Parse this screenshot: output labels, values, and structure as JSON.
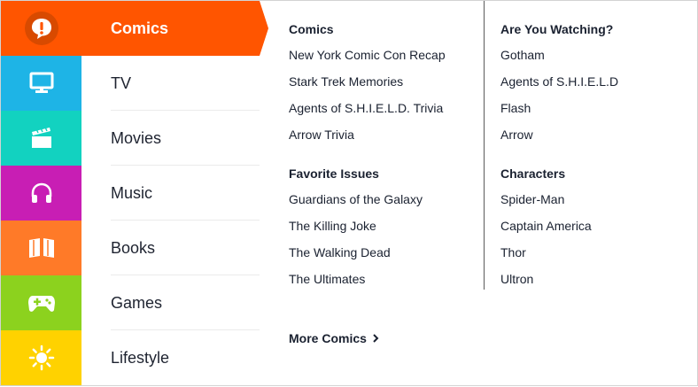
{
  "nav": {
    "items": [
      {
        "label": "Comics",
        "icon": "comics-icon",
        "color": "#ff5500",
        "active": true
      },
      {
        "label": "TV",
        "icon": "tv-icon",
        "color": "#1eb4e6"
      },
      {
        "label": "Movies",
        "icon": "movies-icon",
        "color": "#12d2c0"
      },
      {
        "label": "Music",
        "icon": "headphones-icon",
        "color": "#c81eb4"
      },
      {
        "label": "Books",
        "icon": "books-icon",
        "color": "#ff7a28"
      },
      {
        "label": "Games",
        "icon": "gamepad-icon",
        "color": "#8cd21e"
      },
      {
        "label": "Lifestyle",
        "icon": "sun-icon",
        "color": "#ffd200"
      }
    ]
  },
  "panel": {
    "left": {
      "groups": [
        {
          "title": "Comics",
          "links": [
            "New York Comic Con Recap",
            "Stark Trek Memories",
            "Agents of S.H.I.E.L.D. Trivia",
            "Arrow Trivia"
          ]
        },
        {
          "title": "Favorite Issues",
          "links": [
            "Guardians of the Galaxy",
            "The Killing Joke",
            "The Walking Dead",
            "The Ultimates"
          ]
        }
      ]
    },
    "right": {
      "groups": [
        {
          "title": "Are You Watching?",
          "links": [
            "Gotham",
            "Agents of S.H.I.E.L.D",
            "Flash",
            "Arrow"
          ]
        },
        {
          "title": "Characters",
          "links": [
            "Spider-Man",
            "Captain America",
            "Thor",
            "Ultron"
          ]
        }
      ]
    },
    "more_label": "More Comics",
    "more_icon": "chevron-right-icon"
  }
}
